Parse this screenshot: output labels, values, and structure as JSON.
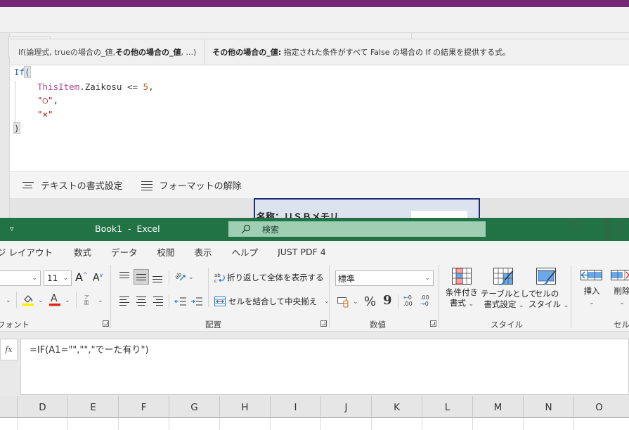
{
  "powerapps": {
    "hint": {
      "signature_prefix": "If(論理式, trueの場合の_値, ",
      "signature_active": "その他の場合の_値",
      "signature_suffix": ", ...)",
      "param_name": "その他の場合の_値:",
      "param_desc": " 指定された条件がすべて False の場合の If の結果を提供する式。"
    },
    "code": {
      "line1_kw": "If",
      "line1_paren": "(",
      "line2_ident": "ThisItem",
      "line2_rest": ".Zaikosu <= ",
      "line2_num": "5",
      "line2_comma": ",",
      "line3_str": "\"○\"",
      "line3_comma": ",",
      "line4_str": "\"×\"",
      "line5_paren": ")"
    },
    "format_bar": {
      "format_text_label": "テキストの書式設定",
      "remove_format_label": "フォーマットの解除"
    },
    "gallery_item_text": "名称：ＵＳＢメモリ"
  },
  "excel": {
    "title": "Book1  -  Excel",
    "search_placeholder": "検索",
    "tabs": [
      "ジ レイアウト",
      "数式",
      "データ",
      "校閲",
      "表示",
      "ヘルプ",
      "JUST PDF 4"
    ],
    "ribbon": {
      "font_size": "11",
      "font_group_label": "フォント",
      "alignment_group_label": "配置",
      "wrap_text_label": "折り返して全体を表示する",
      "merge_center_label": "セルを結合して中央揃え",
      "number_format_value": "標準",
      "number_group_label": "数値",
      "conditional_format_label_1": "条件付き",
      "conditional_format_label_2": "書式",
      "format_as_table_label_1": "テーブルとして",
      "format_as_table_label_2": "書式設定",
      "cell_styles_label_1": "セルの",
      "cell_styles_label_2": "スタイル",
      "styles_group_label": "スタイル",
      "insert_label": "挿入",
      "delete_label": "削除",
      "cells_group_label": "セル",
      "percent_symbol": "%",
      "comma_symbol": "9",
      "increase_decimal": "←0 .00",
      "decrease_decimal": ".00 →0",
      "phonetic_glyph": "ア亜"
    },
    "fx_label": "fx",
    "formula": "=IF(A1=\"\",\"\",\"でーた有り\")",
    "columns": [
      "D",
      "E",
      "F",
      "G",
      "H",
      "I",
      "J",
      "K",
      "L",
      "M",
      "N",
      "O"
    ]
  }
}
